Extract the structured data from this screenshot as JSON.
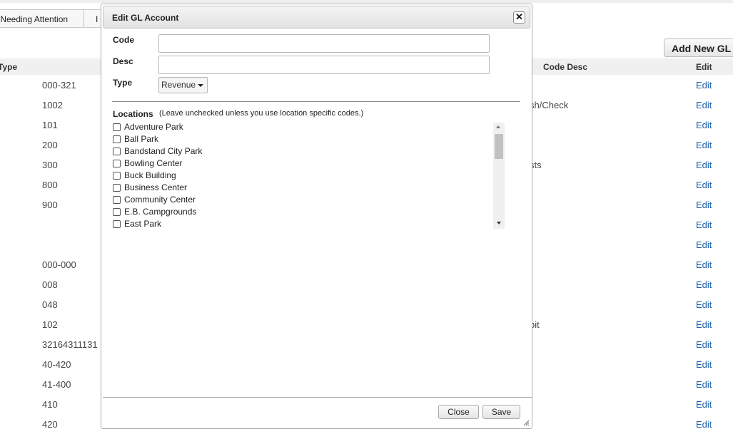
{
  "page": {
    "tab_attention": "s Needing Attention",
    "tab_next": "I",
    "add_button": "Add New GL",
    "columns": {
      "type": "Type",
      "code_desc": "Code Desc",
      "edit": "Edit"
    },
    "rows": [
      {
        "code": "000-321",
        "desc": "",
        "edit": "Edit"
      },
      {
        "code": "1002",
        "desc": "sh/Check",
        "edit": "Edit"
      },
      {
        "code": "101",
        "desc": "",
        "edit": "Edit"
      },
      {
        "code": "200",
        "desc": "",
        "edit": "Edit"
      },
      {
        "code": "300",
        "desc": "sts",
        "edit": "Edit"
      },
      {
        "code": "800",
        "desc": "",
        "edit": "Edit"
      },
      {
        "code": "900",
        "desc": "",
        "edit": "Edit"
      },
      {
        "code": "",
        "desc": "",
        "edit": "Edit"
      },
      {
        "code": "",
        "desc": "",
        "edit": "Edit"
      },
      {
        "code": "000-000",
        "desc": "",
        "edit": "Edit"
      },
      {
        "code": "008",
        "desc": "",
        "edit": "Edit"
      },
      {
        "code": "048",
        "desc": "",
        "edit": "Edit"
      },
      {
        "code": "102",
        "desc": "bit",
        "edit": "Edit"
      },
      {
        "code": "32164311131",
        "desc": "",
        "edit": "Edit"
      },
      {
        "code": "40-420",
        "desc": "",
        "edit": "Edit"
      },
      {
        "code": "41-400",
        "desc": "",
        "edit": "Edit"
      },
      {
        "code": "410",
        "desc": "",
        "edit": "Edit"
      },
      {
        "code": "420",
        "desc": "",
        "edit": "Edit"
      }
    ]
  },
  "dialog": {
    "title": "Edit GL Account",
    "code_label": "Code",
    "code_value": "",
    "desc_label": "Desc",
    "desc_value": "",
    "type_label": "Type",
    "type_selected": "Revenue",
    "locations_label": "Locations",
    "locations_hint": "(Leave unchecked unless you use location specific codes.)",
    "locations": [
      {
        "name": "Adventure Park",
        "checked": false
      },
      {
        "name": "Ball Park",
        "checked": false
      },
      {
        "name": "Bandstand City Park",
        "checked": false
      },
      {
        "name": "Bowling Center",
        "checked": false
      },
      {
        "name": "Buck Building",
        "checked": false
      },
      {
        "name": "Business Center",
        "checked": false
      },
      {
        "name": "Community Center",
        "checked": false
      },
      {
        "name": "E.B. Campgrounds",
        "checked": false
      },
      {
        "name": "East Park",
        "checked": false
      }
    ],
    "close_button": "Close",
    "save_button": "Save"
  },
  "colors": {
    "link": "#1a5faa",
    "header_bg": "#f0f0f0",
    "dialog_border": "#aaaaaa"
  },
  "icons": {
    "close": "close-icon",
    "dropdown": "chevron-down-icon",
    "resize": "resize-grip-icon"
  }
}
